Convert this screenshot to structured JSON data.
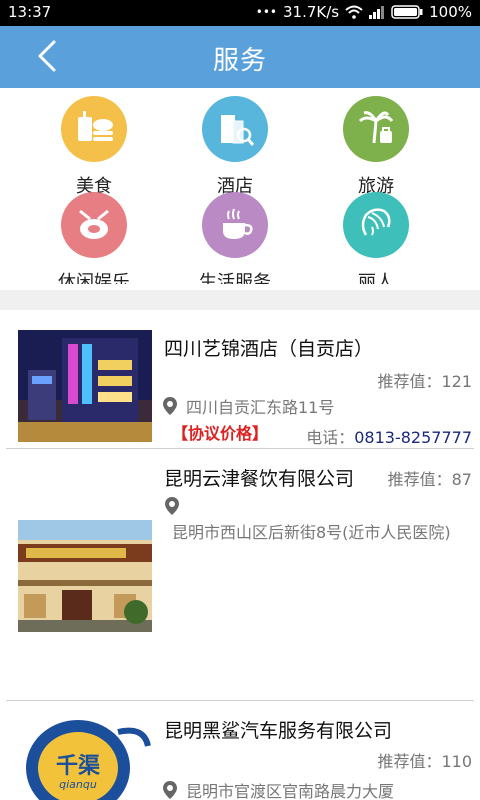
{
  "status": {
    "time": "13:37",
    "dots": "•••",
    "speed": "31.7K/s",
    "battery": "100%"
  },
  "header": {
    "title": "服务"
  },
  "categories": [
    {
      "label": "美食",
      "color": "#f5c04a",
      "icon": "food-icon"
    },
    {
      "label": "酒店",
      "color": "#58b6dd",
      "icon": "hotel-icon"
    },
    {
      "label": "旅游",
      "color": "#7eb14c",
      "icon": "travel-icon"
    },
    {
      "label": "休闲娱乐",
      "color": "#e77e84",
      "icon": "entertainment-icon"
    },
    {
      "label": "生活服务",
      "color": "#b98ac4",
      "icon": "life-service-icon"
    },
    {
      "label": "丽人",
      "color": "#3fbfb9",
      "icon": "beauty-icon"
    }
  ],
  "listings": [
    {
      "name": "四川艺锦酒店（自贡店）",
      "recommend": "推荐值：121",
      "address": "四川自贡汇东路11号",
      "tag": "【协议价格】",
      "phone_label": "电话：",
      "phone": "0813-8257777"
    },
    {
      "name": "昆明云津餐饮有限公司",
      "recommend": "推荐值：87",
      "address": "昆明市西山区后新街8号(近市人民医院)"
    },
    {
      "name": "昆明黑鲨汽车服务有限公司",
      "recommend": "推荐值：110",
      "address": "昆明市官渡区官南路晨力大厦",
      "logo_text": "千渠",
      "logo_sub": "qianqu"
    }
  ]
}
